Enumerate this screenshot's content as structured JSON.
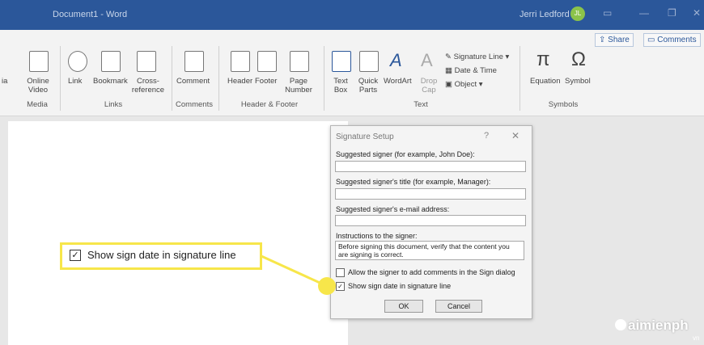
{
  "title_bar": {
    "document_title": "Document1 - Word",
    "user_name": "Jerri Ledford",
    "user_initials": "JL",
    "ribbon_display_icon": "ribbon-display-options-icon",
    "minimize_icon": "minimize-icon",
    "restore_icon": "restore-icon",
    "close_icon": "close-icon"
  },
  "ribbon_top": {
    "share_label": "Share",
    "comments_label": "Comments"
  },
  "ribbon": {
    "partial_label": "ia",
    "media": {
      "online_video": "Online Video",
      "group": "Media"
    },
    "links": {
      "link": "Link",
      "bookmark": "Bookmark",
      "cross_reference": "Cross-reference",
      "group": "Links"
    },
    "comments": {
      "comment": "Comment",
      "group": "Comments"
    },
    "header_footer": {
      "header": "Header",
      "footer": "Footer",
      "page_number": "Page Number",
      "group": "Header & Footer"
    },
    "text": {
      "text_box": "Text Box",
      "quick_parts": "Quick Parts",
      "wordart": "WordArt",
      "drop_cap": "Drop Cap",
      "signature_line": "Signature Line",
      "date_time": "Date & Time",
      "object": "Object",
      "group": "Text"
    },
    "symbols": {
      "equation": "Equation",
      "symbol": "Symbol",
      "group": "Symbols"
    }
  },
  "dialog": {
    "title": "Signature Setup",
    "help": "?",
    "close": "✕",
    "signer_label": "Suggested signer (for example, John Doe):",
    "signer_value": "",
    "title_label": "Suggested signer's title (for example, Manager):",
    "title_value": "",
    "email_label": "Suggested signer's e-mail address:",
    "email_value": "",
    "instructions_label": "Instructions to the signer:",
    "instructions_value": "Before signing this document, verify that the content you are signing is correct.",
    "allow_comments_label": "Allow the signer to add comments in the Sign dialog",
    "allow_comments_checked": false,
    "show_date_label": "Show sign date in signature line",
    "show_date_checked": true,
    "ok_label": "OK",
    "cancel_label": "Cancel"
  },
  "callout": {
    "label": "Show sign date in signature line",
    "check": "✓"
  },
  "watermark": {
    "text": "aimienph",
    "sub": "vn"
  },
  "colors": {
    "word_blue": "#2b579a",
    "callout_yellow": "#f7e64a"
  }
}
